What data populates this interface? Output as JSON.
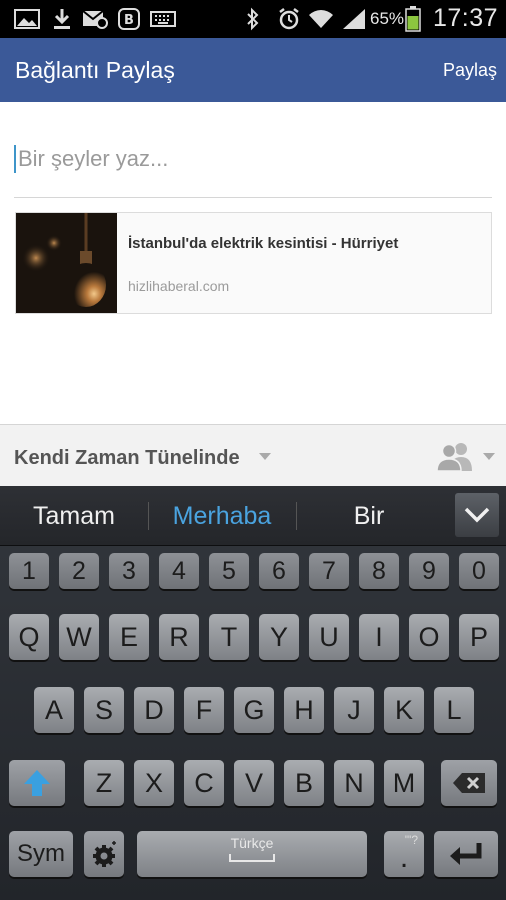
{
  "status_bar": {
    "battery_percent": "65%",
    "time": "17:37",
    "icons": [
      "gallery-icon",
      "download-icon",
      "mail-icon",
      "app-icon",
      "keyboard-icon",
      "bluetooth-icon",
      "alarm-icon",
      "wifi-icon",
      "signal-icon",
      "battery-icon"
    ]
  },
  "action_bar": {
    "title": "Bağlantı Paylaş",
    "share_label": "Paylaş",
    "color": "#3b5998"
  },
  "compose": {
    "placeholder": "Bir şeyler yaz..."
  },
  "link_preview": {
    "title": "İstanbul'da elektrik kesintisi - Hürriyet",
    "domain": "hizlihaberal.com"
  },
  "audience": {
    "label": "Kendi Zaman Tünelinde"
  },
  "suggestions": {
    "items": [
      "Tamam",
      "Merhaba",
      "Bir"
    ],
    "active_index": 1,
    "accent": "#4aa3df"
  },
  "keyboard": {
    "number_row": [
      "1",
      "2",
      "3",
      "4",
      "5",
      "6",
      "7",
      "8",
      "9",
      "0"
    ],
    "row1": [
      "Q",
      "W",
      "E",
      "R",
      "T",
      "Y",
      "U",
      "I",
      "O",
      "P"
    ],
    "row2": [
      "A",
      "S",
      "D",
      "F",
      "G",
      "H",
      "J",
      "K",
      "L"
    ],
    "row3": [
      "Z",
      "X",
      "C",
      "V",
      "B",
      "N",
      "M"
    ],
    "sym_label": "Sym",
    "space_label": "Türkçe",
    "period_label": ".",
    "period_hint": "'\"?",
    "shift_color": "#3aa0e0"
  }
}
